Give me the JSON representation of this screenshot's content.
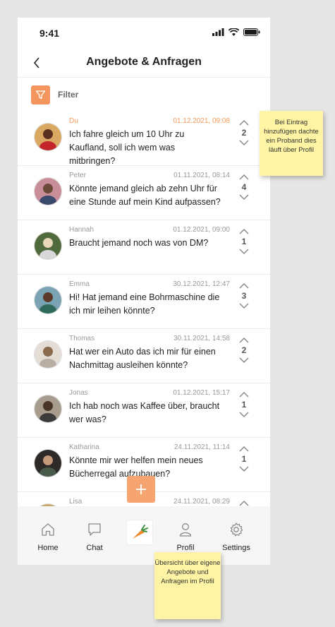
{
  "status": {
    "time": "9:41"
  },
  "header": {
    "title": "Angebote & Anfragen"
  },
  "filter": {
    "label": "Filter"
  },
  "posts": [
    {
      "author": "Du",
      "timestamp": "01.12.2021, 09:08",
      "message": "Ich fahre gleich um 10 Uhr zu Kaufland, soll ich wem was mitbringen?",
      "votes": "2",
      "is_me": true
    },
    {
      "author": "Peter",
      "timestamp": "01.11.2021, 08:14",
      "message": "Könnte jemand gleich ab zehn Uhr für eine Stunde auf mein Kind aufpassen?",
      "votes": "4"
    },
    {
      "author": "Hannah",
      "timestamp": "01.12.2021, 09:00",
      "message": "Braucht jemand noch was von DM?",
      "votes": "1"
    },
    {
      "author": "Emma",
      "timestamp": "30.12.2021, 12:47",
      "message": "Hi! Hat jemand eine Bohrmaschine die ich mir leihen könnte?",
      "votes": "3"
    },
    {
      "author": "Thomas",
      "timestamp": "30.11.2021, 14:58",
      "message": "Hat wer ein Auto das ich mir für einen Nachmittag ausleihen könnte?",
      "votes": "2"
    },
    {
      "author": "Jonas",
      "timestamp": "01.12.2021, 15:17",
      "message": "Ich hab noch was Kaffee über, braucht wer was?",
      "votes": "1"
    },
    {
      "author": "Katharina",
      "timestamp": "24.11.2021, 11:14",
      "message": "Könnte mir wer helfen mein neues Bücherregal aufzubauen?",
      "votes": "1"
    },
    {
      "author": "Lisa",
      "timestamp": "24.11.2021, 08:29",
      "message": "",
      "votes": ""
    }
  ],
  "tabbar": {
    "home": "Home",
    "chat": "Chat",
    "profil": "Profil",
    "settings": "Settings"
  },
  "notes": {
    "note1": "Bei Eintrag hinzufügen dachte ein Proband dies läuft über Profil",
    "note2": "Übersicht über eigene Angebote und Anfragen im Profil"
  },
  "colors": {
    "accent": "#f4955d",
    "sticky": "#fff4a3"
  }
}
